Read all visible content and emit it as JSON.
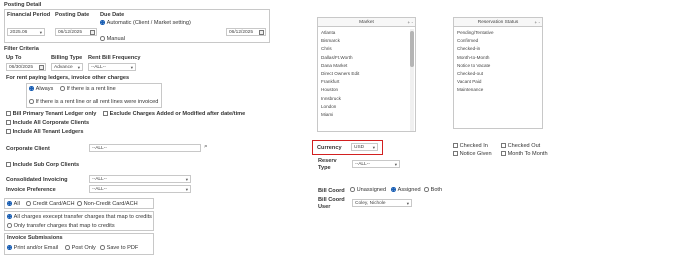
{
  "posting": {
    "title": "Posting Detail",
    "financial_period_label": "Financial Period",
    "financial_period_value": "2025.06",
    "posting_date_label": "Posting Date",
    "posting_date_value": "06/12/2025",
    "due_date_label": "Due Date",
    "due_auto_label": "Automatic (Client / Market setting)",
    "due_manual_label": "Manual",
    "due_date_value": "06/12/2025"
  },
  "filter": {
    "title": "Filter Criteria",
    "up_to_label": "Up To",
    "up_to_value": "06/30/2025",
    "billing_type_label": "Billing Type",
    "billing_type_value": "Advance",
    "rent_bill_label": "Rent Bill Frequency",
    "rent_bill_value": "--ALL--",
    "rent_paying_label": "For rent paying ledgers, invoice other charges",
    "always_label": "Always",
    "if_rent_label": "If there is a rent line",
    "if_rent_or_all_label": "If there is a rent line or all rent lines were invoiced",
    "bill_primary_label": "Bill Primary Tenant Ledger only",
    "exclude_charges_label": "Exclude Charges Added or Modified after date/time",
    "include_corporate_label": "Include All Corporate Clients",
    "include_tenant_label": "Include All Tenant Ledgers",
    "corporate_client_label": "Corporate Client",
    "corporate_client_value": "--ALL--",
    "include_sub_corp_label": "Include Sub Corp Clients",
    "consolidated_label": "Consolidated Invoicing",
    "consolidated_value": "--ALL--",
    "invoice_pref_label": "Invoice Preference",
    "invoice_pref_value": "--ALL--",
    "pay_all_label": "All",
    "pay_card_label": "Credit Card/ACH",
    "pay_noncard_label": "Non-Credit Card/ACH",
    "transfer_all_label": "All charges execept transfer charges that map to credits",
    "transfer_only_label": "Only transfer charges that map to credits",
    "submissions_title": "Invoice Submissions",
    "sub_print_label": "Print and/or Email",
    "sub_post_label": "Post Only",
    "sub_pdf_label": "Save to PDF"
  },
  "market": {
    "header": "Market",
    "header_controls": "+ -",
    "items": [
      "Atlanta",
      "Bismarck",
      "Chris",
      "Dallas/Ft.Worth",
      "Dana Market",
      "Direct Owners Edit",
      "Frankfurt",
      "Houston",
      "Innsbruck",
      "London",
      "Miami"
    ]
  },
  "reservation": {
    "header": "Reservation Status",
    "header_controls": "+ -",
    "items": [
      "Pending/Tentative",
      "Confirmed",
      "Checked-in",
      "Month-to-Month",
      "Notice to Vacate",
      "Checked-out",
      "Vacant Paid",
      "Maintenance"
    ]
  },
  "currency": {
    "label": "Currency",
    "value": "USD"
  },
  "status_checks": {
    "checked_in": "Checked In",
    "checked_out": "Checked Out",
    "notice_given": "Notice Given",
    "month_to_month": "Month To Month"
  },
  "reserv_type": {
    "label_line1": "Reserv",
    "label_line2": "Type",
    "value": "--ALL--"
  },
  "bill_coord": {
    "label": "Bill Coord",
    "unassigned": "Unassigned",
    "assigned": "Assigned",
    "both": "Both",
    "user_label_line1": "Bill Coord",
    "user_label_line2": "User",
    "user_value": "Coley, Nichole"
  },
  "colors": {
    "highlight": "#d22020",
    "radio_on": "#1a5fb4"
  }
}
